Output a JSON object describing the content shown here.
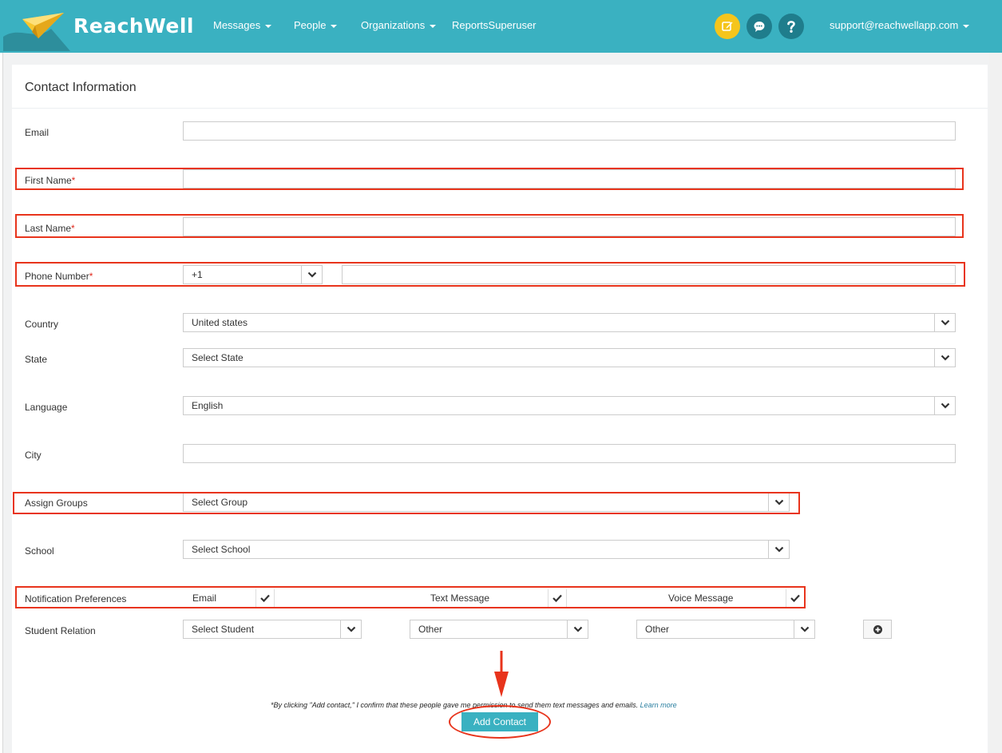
{
  "app": {
    "brand": "ReachWell"
  },
  "nav": {
    "items": [
      {
        "label": "Messages",
        "has_caret": true
      },
      {
        "label": "People",
        "has_caret": true
      },
      {
        "label": "Organizations",
        "has_caret": true
      },
      {
        "label": "ReportsSuperuser",
        "has_caret": false
      }
    ],
    "user_email": "support@reachwellapp.com",
    "icons": [
      "compose-icon",
      "chat-icon",
      "help-icon"
    ]
  },
  "form": {
    "title": "Contact Information",
    "email_label": "Email",
    "first_name_label": "First Name",
    "last_name_label": "Last Name",
    "phone_label": "Phone Number",
    "required_mark": "*",
    "phone_code": "+1",
    "country_label": "Country",
    "country_value": "United states",
    "state_label": "State",
    "state_value": "Select State",
    "language_label": "Language",
    "language_value": "English",
    "city_label": "City",
    "groups_label": "Assign Groups",
    "groups_value": "Select Group",
    "school_label": "School",
    "school_value": "Select School",
    "notif_label": "Notification Preferences",
    "notif_email": "Email",
    "notif_text": "Text Message",
    "notif_voice": "Voice Message",
    "relation_label": "Student Relation",
    "relation_student": "Select Student",
    "relation_type_1": "Other",
    "relation_type_2": "Other",
    "disclaimer": "*By clicking \"Add contact,\" I confirm that these people gave me permission to send them text messages and emails.",
    "learn_more": "Learn more",
    "submit_label": "Add Contact"
  },
  "colors": {
    "brand": "#3ab1c1",
    "highlight": "#e8341c",
    "yellow_btn": "#f5c51c"
  }
}
